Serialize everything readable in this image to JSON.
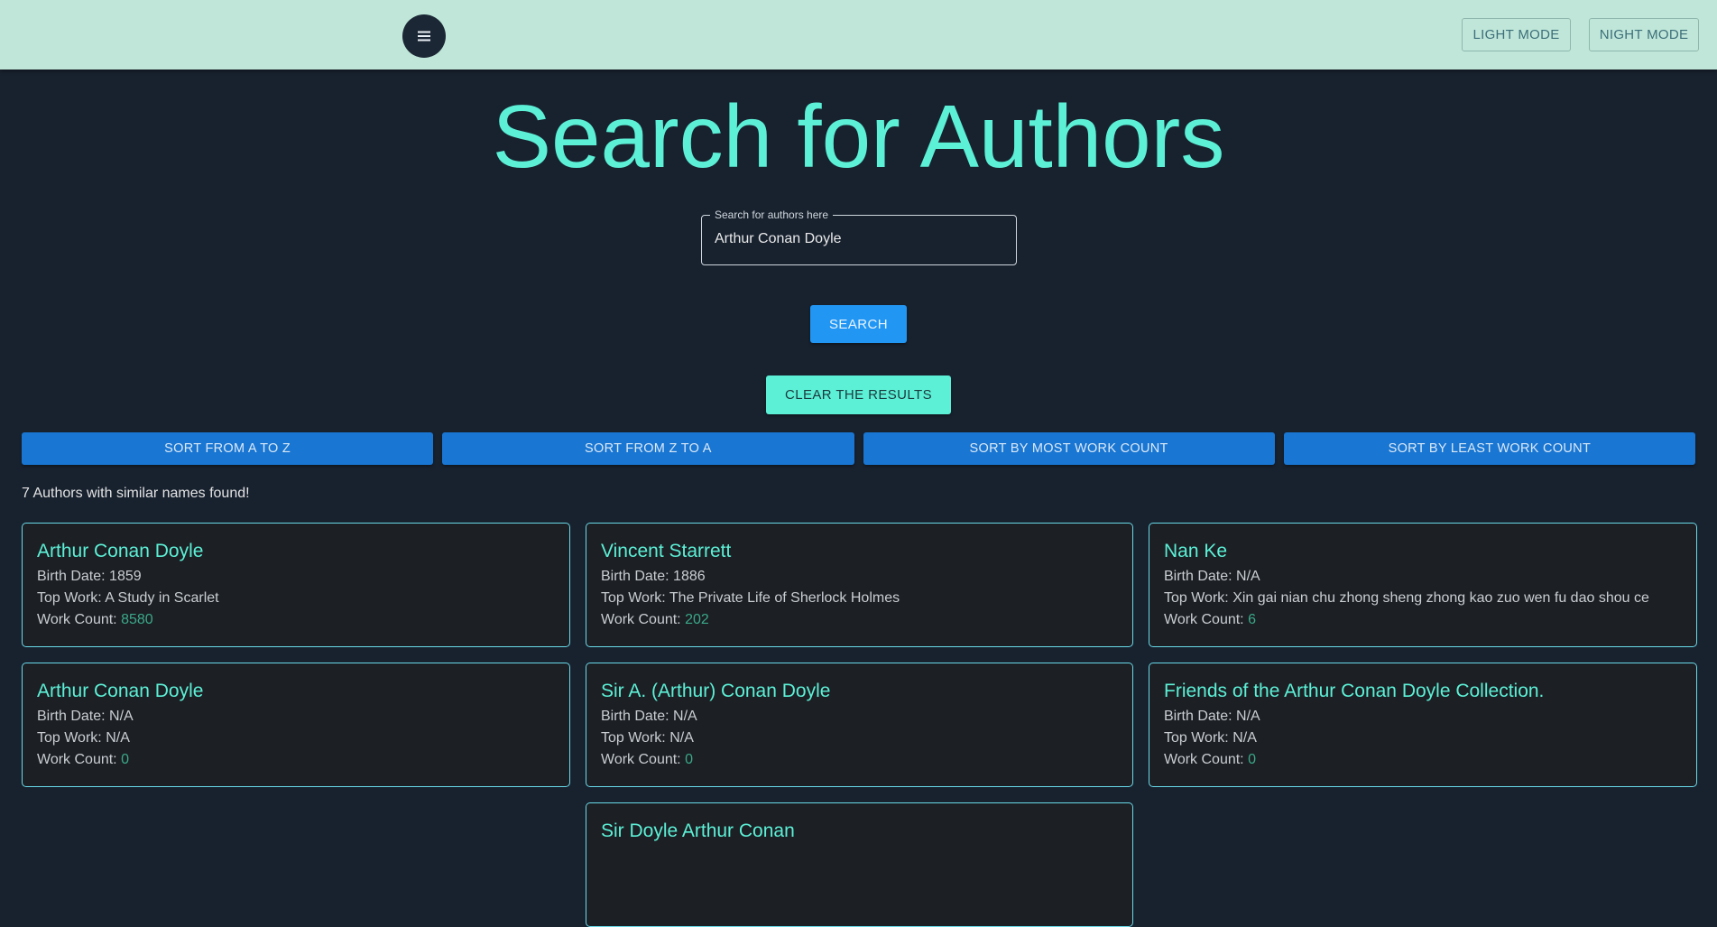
{
  "header": {
    "light_mode_label": "LIGHT MODE",
    "night_mode_label": "NIGHT MODE"
  },
  "page": {
    "title": "Search for Authors"
  },
  "search": {
    "label": "Search for authors here",
    "value": "Arthur Conan Doyle",
    "button_label": "SEARCH",
    "clear_label": "CLEAR THE RESULTS"
  },
  "sort": {
    "a_to_z": "SORT FROM A TO Z",
    "z_to_a": "SORT FROM Z TO A",
    "most": "SORT BY MOST WORK COUNT",
    "least": "SORT BY LEAST WORK COUNT"
  },
  "results": {
    "count_text": "7 Authors with similar names found!",
    "birth_label": "Birth Date:",
    "topwork_label": "Top Work:",
    "count_label": "Work Count:",
    "authors": [
      {
        "name": "Arthur Conan Doyle",
        "birth": "1859",
        "top_work": "A Study in Scarlet",
        "work_count": "8580"
      },
      {
        "name": "Vincent Starrett",
        "birth": "1886",
        "top_work": "The Private Life of Sherlock Holmes",
        "work_count": "202"
      },
      {
        "name": "Nan Ke",
        "birth": "N/A",
        "top_work": "Xin gai nian chu zhong sheng zhong kao zuo wen fu dao shou ce",
        "work_count": "6"
      },
      {
        "name": "Arthur Conan Doyle",
        "birth": "N/A",
        "top_work": "N/A",
        "work_count": "0"
      },
      {
        "name": "Sir A. (Arthur) Conan Doyle",
        "birth": "N/A",
        "top_work": "N/A",
        "work_count": "0"
      },
      {
        "name": "Friends of the Arthur Conan Doyle Collection.",
        "birth": "N/A",
        "top_work": "N/A",
        "work_count": "0"
      },
      {
        "name": "Sir Doyle Arthur Conan",
        "birth": "",
        "top_work": "",
        "work_count": ""
      }
    ]
  },
  "colors": {
    "header_bg": "#bfe6d8",
    "page_bg": "#18222f",
    "accent": "#5cf0d6",
    "primary": "#2196f3",
    "sort_blue": "#1976d2"
  }
}
